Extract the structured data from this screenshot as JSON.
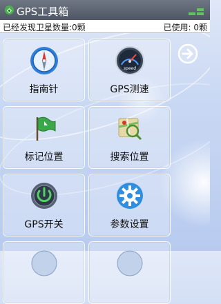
{
  "header": {
    "title": "GPS工具箱"
  },
  "status": {
    "found": "已经发现卫星数量:0颗",
    "used": "已使用: 0颗"
  },
  "tiles": [
    {
      "label": "指南针",
      "icon": "compass-icon"
    },
    {
      "label": "GPS测速",
      "icon": "speedometer-icon"
    },
    {
      "label": "标记位置",
      "icon": "flag-icon"
    },
    {
      "label": "搜索位置",
      "icon": "map-search-icon"
    },
    {
      "label": "GPS开关",
      "icon": "power-switch-icon"
    },
    {
      "label": "参数设置",
      "icon": "settings-gear-icon"
    }
  ],
  "speedo_text": "speed",
  "nav": {
    "next_icon": "arrow-right-circle-icon"
  }
}
